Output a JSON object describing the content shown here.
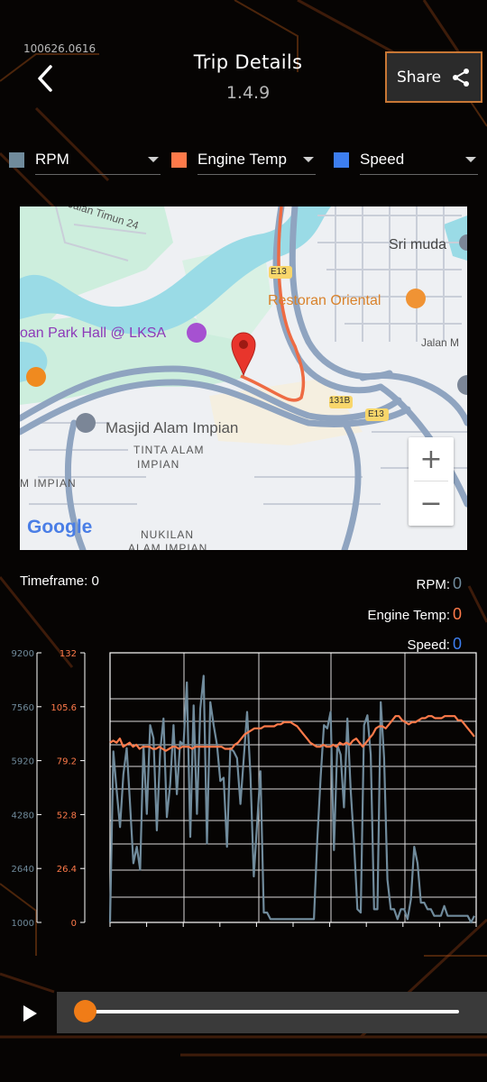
{
  "header": {
    "build_id": "100626.0616",
    "title": "Trip Details",
    "version": "1.4.9",
    "share_label": "Share"
  },
  "selectors": [
    {
      "label": "RPM",
      "color": "#708b9c"
    },
    {
      "label": "Engine Temp",
      "color": "#ff7a4a"
    },
    {
      "label": "Speed",
      "color": "#3d7ef0"
    }
  ],
  "map": {
    "labels": {
      "street_timun": "Jalan Timun 24",
      "sri_muda": "Sri muda",
      "restoran": "Restoran Oriental",
      "park_hall": "oan Park Hall @ LKSA",
      "jalan_m": "Jalan M",
      "e13_a": "E13",
      "e13_b": "E13",
      "exit_131b": "131B",
      "masjid": "Masjid Alam Impian",
      "tinta_1": "TINTA ALAM",
      "tinta_2": "IMPIAN",
      "m_impian": "M IMPIAN",
      "nukilan_1": "NUKILAN",
      "nukilan_2": "ALAM IMPIAN",
      "google": "Google"
    },
    "zoom_in": "+",
    "zoom_out": "−"
  },
  "stats": {
    "timeframe_label": "Timeframe:",
    "timeframe_value": "0",
    "rpm_label": "RPM:",
    "rpm_value": "0",
    "temp_label": "Engine Temp:",
    "temp_value": "0",
    "speed_label": "Speed:",
    "speed_value": "0"
  },
  "player": {
    "position": 0.0
  },
  "chart_data": {
    "type": "line",
    "title": "",
    "rpm_axis": {
      "ticks": [
        "9200",
        "7560",
        "5920",
        "4280",
        "2640",
        "1000"
      ],
      "ylim": [
        1000,
        9200
      ],
      "color": "#708b9c"
    },
    "temp_axis": {
      "ticks": [
        "132",
        "105.6",
        "79.2",
        "52.8",
        "26.4",
        "0"
      ],
      "ylim": [
        0,
        132
      ],
      "color": "#ff7a4a"
    },
    "grid": true,
    "series": [
      {
        "name": "RPM",
        "color": "#708b9c",
        "axis": "rpm",
        "values": [
          1000,
          6200,
          5000,
          3900,
          5500,
          6300,
          4600,
          2800,
          3300,
          2600,
          6400,
          4300,
          7000,
          6600,
          3800,
          6200,
          7200,
          4200,
          5200,
          7000,
          4900,
          6500,
          6400,
          8300,
          3600,
          7600,
          4300,
          7500,
          8500,
          3400,
          7700,
          7000,
          6400,
          5300,
          5400,
          3300,
          6300,
          6200,
          6000,
          4600,
          6000,
          7400,
          5500,
          2400,
          4000,
          5600,
          1300,
          1300,
          1100,
          1100,
          1100,
          1100,
          1100,
          1100,
          1100,
          1100,
          1100,
          1100,
          1100,
          1100,
          1100,
          1100,
          3500,
          5400,
          7000,
          6900,
          7400,
          3200,
          6400,
          6100,
          4500,
          7200,
          5000,
          3400,
          1400,
          1300,
          7000,
          7300,
          6100,
          1400,
          1400,
          7700,
          6000,
          2300,
          1400,
          1400,
          1100,
          1400,
          1400,
          1100,
          1700,
          3300,
          2800,
          1600,
          1600,
          1400,
          1400,
          1200,
          1200,
          1200,
          1500,
          1200,
          1200,
          1200,
          1200,
          1200,
          1200,
          1200,
          1000,
          1200
        ]
      },
      {
        "name": "Engine Temp",
        "color": "#ff7a4a",
        "axis": "temp",
        "values": [
          88,
          89,
          88,
          90,
          86,
          87,
          88,
          86,
          87,
          85,
          86,
          86,
          86,
          85,
          85,
          86,
          85,
          84,
          85,
          86,
          86,
          85,
          86,
          86,
          86,
          85,
          86,
          86,
          86,
          86,
          86,
          86,
          86,
          86,
          86,
          85,
          85,
          85,
          87,
          88,
          90,
          92,
          93,
          94,
          95,
          95,
          95,
          96,
          96,
          96,
          96,
          97,
          97,
          98,
          98,
          98,
          97,
          96,
          94,
          92,
          90,
          88,
          87,
          86,
          86,
          87,
          86,
          86,
          87,
          86,
          88,
          87,
          88,
          87,
          89,
          90,
          88,
          86,
          88,
          90,
          92,
          95,
          96,
          96,
          95,
          97,
          99,
          101,
          101,
          99,
          98,
          97,
          98,
          98,
          99,
          100,
          100,
          101,
          101,
          100,
          100,
          100,
          101,
          101,
          101,
          101,
          99,
          99,
          97,
          95,
          93,
          91
        ]
      }
    ]
  }
}
